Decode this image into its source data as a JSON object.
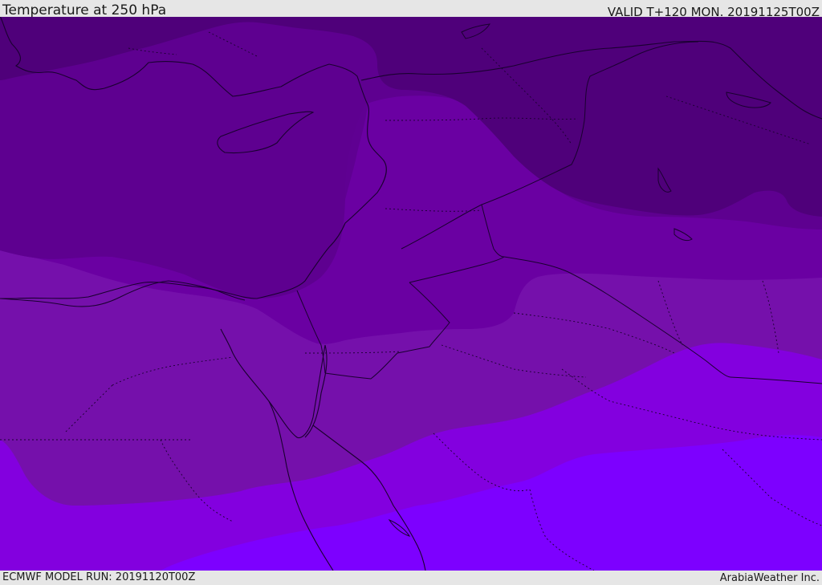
{
  "header": {
    "title": "Temperature at 250 hPa",
    "valid": "VALID T+120 MON. 20191125T00Z"
  },
  "footer": {
    "model_run": "ECMWF MODEL RUN: 20191120T00Z",
    "credit": "ArabiaWeather Inc."
  },
  "map": {
    "field": "temperature",
    "level": "250 hPa",
    "region": "Eastern Mediterranean / Middle East",
    "bands": [
      {
        "name": "coldest-band",
        "color": "#4f007a"
      },
      {
        "name": "cold-band",
        "color": "#5e0090"
      },
      {
        "name": "cool-band",
        "color": "#6a00a2"
      },
      {
        "name": "mid-band",
        "color": "#7510ab"
      },
      {
        "name": "warm-band",
        "color": "#8300df"
      },
      {
        "name": "warmest-band",
        "color": "#7d00ff"
      }
    ]
  }
}
